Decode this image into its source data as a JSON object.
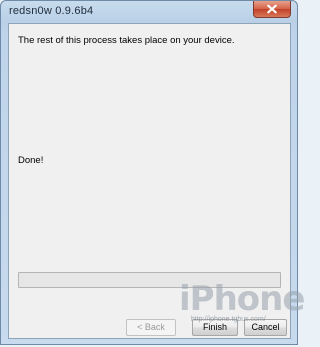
{
  "window": {
    "title": "redsn0w 0.9.6b4"
  },
  "content": {
    "message": "The rest of this process takes place on your device.",
    "status": "Done!"
  },
  "progress": {
    "value": 0
  },
  "buttons": {
    "back": "< Back",
    "finish": "Finish",
    "cancel": "Cancel"
  },
  "watermark": {
    "main": "iPhone",
    "sub": "http://iphone.tgbus.com/"
  },
  "icons": {
    "close": "close-icon"
  },
  "colors": {
    "close_button": "#c24228",
    "title_bar": "#bed4ea",
    "client_bg": "#f0f0f0"
  }
}
